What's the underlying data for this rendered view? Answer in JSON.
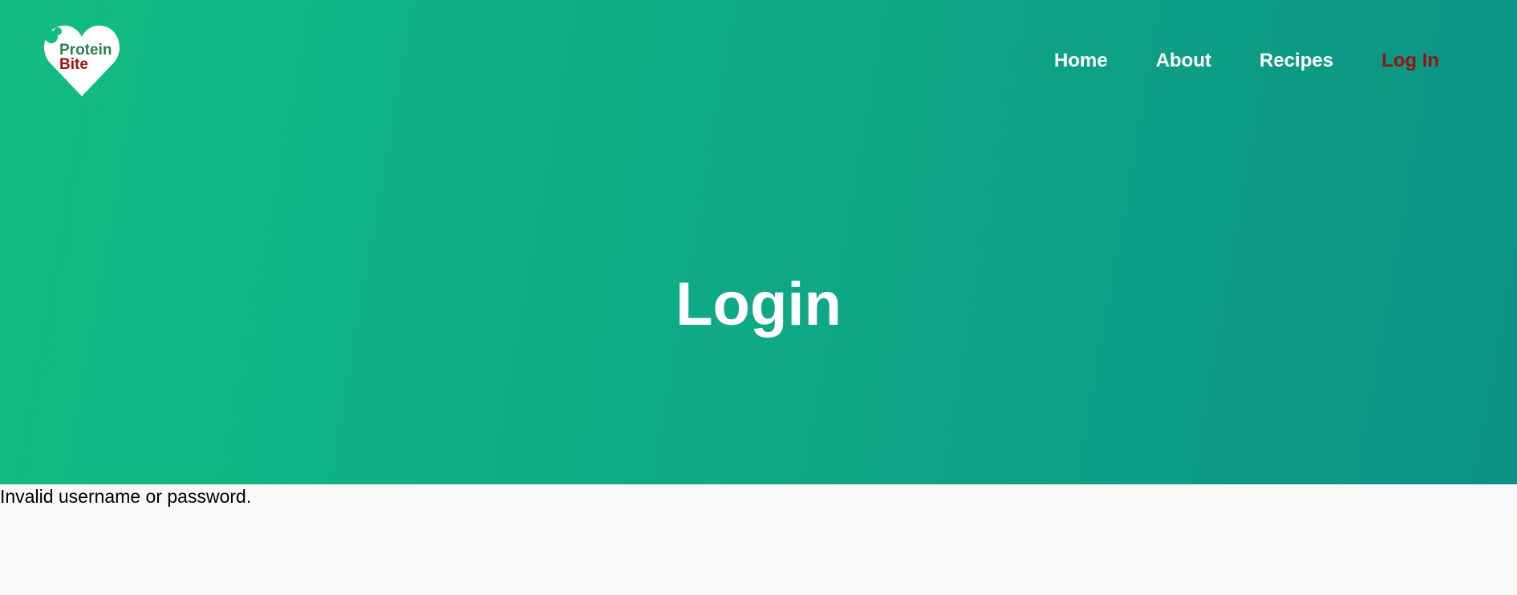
{
  "logo": {
    "line1": "Protein",
    "line2": "Bite",
    "line1_color": "#2e7d4f",
    "line2_color": "#a01212"
  },
  "nav": {
    "home": "Home",
    "about": "About",
    "recipes": "Recipes",
    "login": "Log In",
    "active_color": "#9b1010"
  },
  "hero": {
    "title": "Login",
    "gradient_start": "#12bd83",
    "gradient_end": "#0c9285"
  },
  "message": {
    "error": "Invalid username or password."
  }
}
